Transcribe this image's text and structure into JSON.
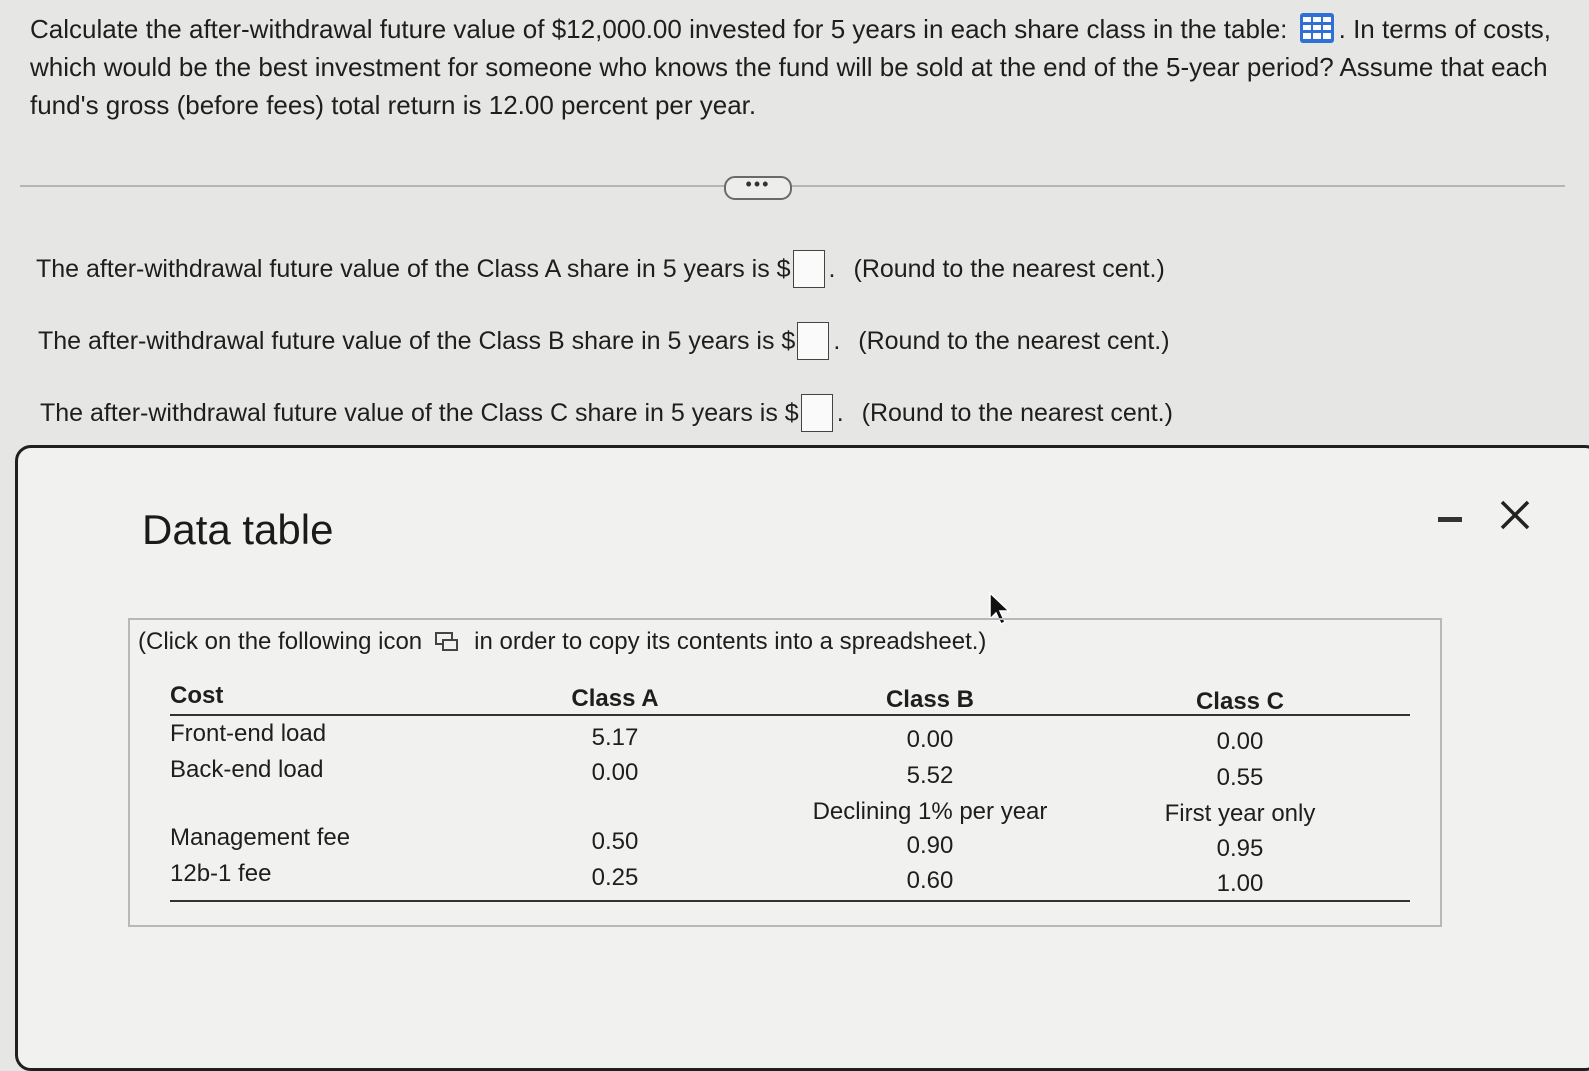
{
  "question": {
    "text_before_icon": "Calculate the after-withdrawal future value of $12,000.00 invested for 5 years in each share class in the table:",
    "text_after_icon": ". In terms of costs, which would be the best investment for someone who knows the fund will be sold at the end of the 5-year period? Assume that each fund's gross (before fees) total return is 12.00 percent per year."
  },
  "more_button": "•••",
  "answers": [
    {
      "prompt": "The after-withdrawal future value of the Class A share in 5 years is $",
      "suffix": ".",
      "note": "(Round to the nearest cent.)"
    },
    {
      "prompt": "The after-withdrawal future value of the Class B share in 5 years is $",
      "suffix": ".",
      "note": "(Round to the nearest cent.)"
    },
    {
      "prompt": "The after-withdrawal future value of the Class C share in 5 years is $",
      "suffix": ".",
      "note": "(Round to the nearest cent.)"
    }
  ],
  "dialog": {
    "title": "Data table",
    "copy_note_before": "(Click on the following icon",
    "copy_note_after": "in order to copy its contents into a spreadsheet.)",
    "table": {
      "headers": [
        "Cost",
        "Class A",
        "Class B",
        "Class C"
      ],
      "rows": [
        {
          "label": "Front-end load",
          "a": "5.17",
          "b": "0.00",
          "c": "0.00"
        },
        {
          "label": "Back-end load",
          "a": "0.00",
          "b": "5.52",
          "c": "0.55"
        },
        {
          "label": "",
          "a": "",
          "b": "Declining 1% per year",
          "c": "First year only"
        },
        {
          "label": "Management fee",
          "a": "0.50",
          "b": "0.90",
          "c": "0.95"
        },
        {
          "label": "12b-1 fee",
          "a": "0.25",
          "b": "0.60",
          "c": "1.00"
        }
      ]
    }
  },
  "icons": {
    "data_table": "grid-icon",
    "copy": "spreadsheet-copy-icon",
    "minimize": "minimize-icon",
    "close": "close-icon",
    "cursor": "mouse-pointer-icon"
  },
  "colors": {
    "accent_blue": "#2f6fd6",
    "page_background": "#e6e6e4",
    "dialog_background": "#f1f1ef"
  }
}
